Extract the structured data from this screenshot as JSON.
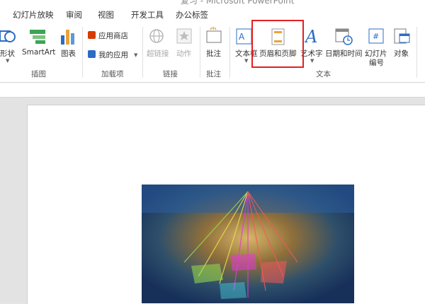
{
  "window": {
    "title": "复习 - Microsoft PowerPoint"
  },
  "tabs": [
    "幻灯片放映",
    "审阅",
    "视图",
    "开发工具",
    "办公标签"
  ],
  "ribbon": {
    "illustrations": {
      "shapes": "形状",
      "smartart": "SmartArt",
      "chart": "图表",
      "group": "插图"
    },
    "addins": {
      "store": "应用商店",
      "my_apps": "我的应用",
      "group": "加载项"
    },
    "links": {
      "hyperlink": "超链接",
      "action": "动作",
      "group": "链接"
    },
    "comments": {
      "comment": "批注",
      "group": "批注"
    },
    "text": {
      "textbox": "文本框",
      "header_footer": "页眉和页脚",
      "wordart": "艺术字",
      "datetime": "日期和时间",
      "slide_number_1": "幻灯片",
      "slide_number_2": "编号",
      "object": "对象",
      "group": "文本"
    }
  },
  "colors": {
    "highlight": "#e32020",
    "accent_blue": "#2b6cc4",
    "store_red": "#d83b01"
  },
  "photo": {
    "alt": ""
  }
}
